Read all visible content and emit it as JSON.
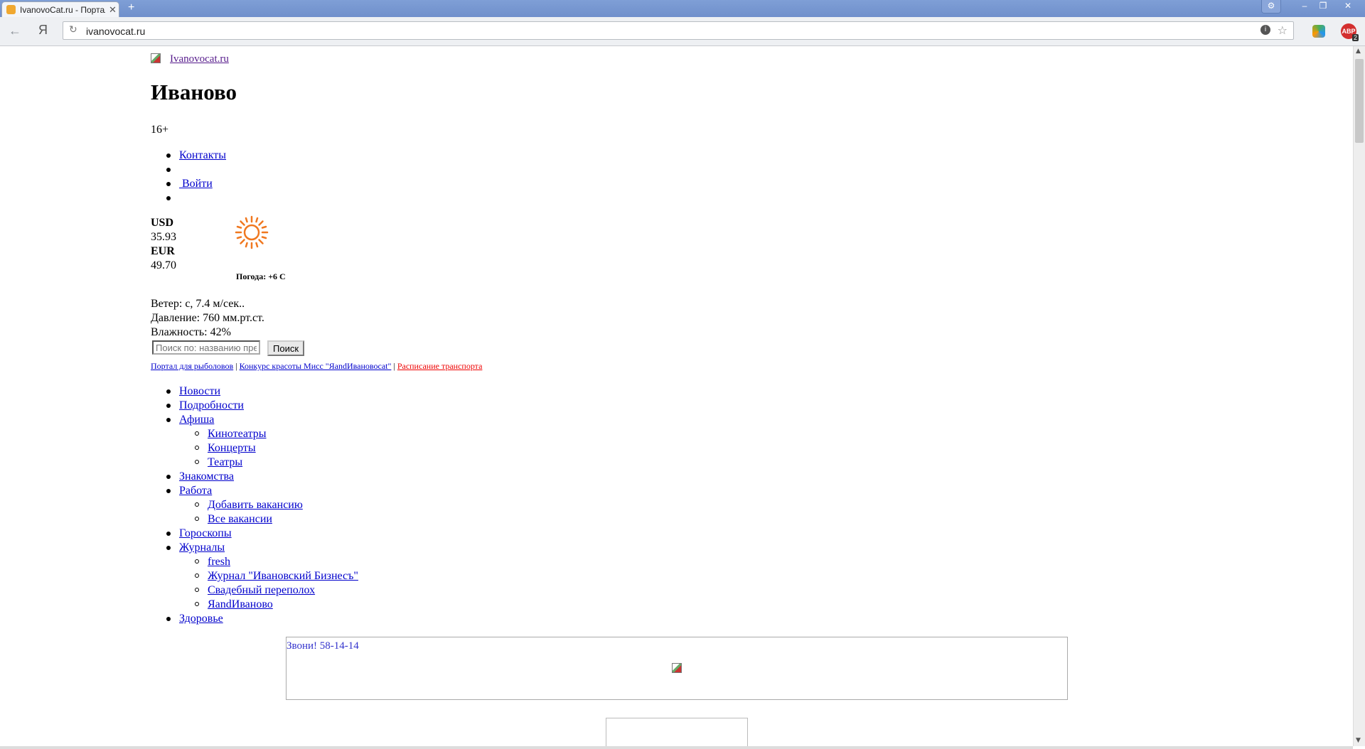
{
  "browser": {
    "tab_title": "IvanovoCat.ru - Портал",
    "url": "ivanovocat.ru",
    "yandex_button": "Я",
    "abp_label": "ABP",
    "abp_count": "2"
  },
  "site": {
    "link": "Ivanovocat.ru",
    "city": "Иваново",
    "age_rating": "16+",
    "top_links": [
      {
        "label": "Контакты"
      },
      {
        "label": ""
      },
      {
        "label": " Войти"
      },
      {
        "label": ""
      }
    ]
  },
  "rates": {
    "usd_label": "USD",
    "usd_value": "35.93",
    "eur_label": "EUR",
    "eur_value": "49.70"
  },
  "weather": {
    "caption": "Погода: +6 С",
    "wind": "Ветер: с, 7.4 м/сек..",
    "pressure": "Давление: 760 мм.рт.ст.",
    "humidity": "Влажность: 42%",
    "icon": "sun-icon"
  },
  "search": {
    "placeholder": "Поиск по: названию пред",
    "button": "Поиск"
  },
  "quicklinks": {
    "fishing": "Портал для рыболовов",
    "sep": "|",
    "contest": "Конкурс красоты Мисс \"ЯandИвановоcat\"",
    "transport": "Расписание транспорта"
  },
  "nav": {
    "news": "Новости",
    "details": "Подробности",
    "afisha": "Афиша",
    "afisha_sub": [
      "Кинотеатры",
      "Концерты",
      "Театры"
    ],
    "dating": "Знакомства",
    "work": "Работа",
    "work_sub": [
      "Добавить вакансию",
      "Все вакансии"
    ],
    "horoscopes": "Гороскопы",
    "magazines": "Журналы",
    "magazines_sub": [
      "fresh",
      "Журнал \"Ивановский Бизнесъ\"",
      "Свадебный переполох",
      "ЯandИваново"
    ],
    "health": "Здоровье"
  },
  "banner": {
    "text": "Звони! 58-14-14"
  },
  "colors": {
    "link": "#0000cc",
    "visited": "#551a8b",
    "transport_link": "#ee0000",
    "sun": "#f07820"
  }
}
